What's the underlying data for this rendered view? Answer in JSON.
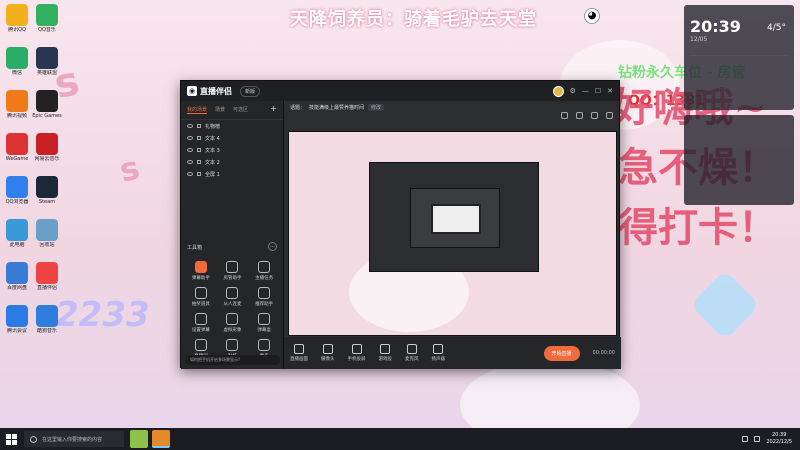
{
  "banner": {
    "title": "天降饲养员：骑着毛驴去天堂"
  },
  "overlay": {
    "fans": "钻粉永久车位 - 房管",
    "qq": "QQ：1381",
    "line1": "~好嗨哦~",
    "line2": "急不燥！",
    "line3": "得打卡！",
    "brand": "2233"
  },
  "desktop_icons": [
    {
      "label": "腾讯QQ",
      "color": "#f2b01e"
    },
    {
      "label": "QQ音乐",
      "color": "#32b060"
    },
    {
      "label": "微信",
      "color": "#2aae67"
    },
    {
      "label": "英雄联盟",
      "color": "#2a3552"
    },
    {
      "label": "腾讯视频",
      "color": "#f07a1a"
    },
    {
      "label": "Epic Games",
      "color": "#222"
    },
    {
      "label": "WeGame",
      "color": "#d33"
    },
    {
      "label": "网易云音乐",
      "color": "#c91f25"
    },
    {
      "label": "QQ浏览器",
      "color": "#2f80ed"
    },
    {
      "label": "Steam",
      "color": "#1b2838"
    },
    {
      "label": "此电脑",
      "color": "#3a9ad9"
    },
    {
      "label": "回收站",
      "color": "#6aa0c8"
    },
    {
      "label": "百度网盘",
      "color": "#3a7bd5"
    },
    {
      "label": "直播伴侣",
      "color": "#e44"
    },
    {
      "label": "腾讯会议",
      "color": "#2c7be5"
    },
    {
      "label": "酷狗音乐",
      "color": "#2f7ddc"
    }
  ],
  "weather_widget": {
    "time": "20:39",
    "temp": "4/5°",
    "date": "12/05"
  },
  "window": {
    "app_name": "直播伴侣",
    "version_tag": "新版",
    "tabs": [
      "我的场景",
      "场景",
      "可选区"
    ],
    "scenes": [
      "礼物榜",
      "文本 4",
      "文本 3",
      "文本 2",
      "全屏 1"
    ],
    "topic_label": "话题：",
    "topic": "技能满级上最赞养猫时间",
    "topic_tag": "修改",
    "tools_title": "工具箱",
    "tools": [
      "弹幕助手",
      "房管助手",
      "主播任务",
      "抽奖道具",
      "从人连麦",
      "推荐助手",
      "设置弹幕",
      "虚拟形象",
      "弹幕盒",
      "直播间",
      "贴纸",
      "更多"
    ],
    "notice": "如何把手机开启多场景显示?",
    "bottom": [
      "直播画面",
      "摄像头",
      "手机投屏",
      "游戏投",
      "麦克风",
      "扬声器"
    ],
    "go_live": "开始直播",
    "timer": "00:00:00"
  },
  "taskbar": {
    "search_placeholder": "在这里输入你要搜索的内容",
    "time": "20:39",
    "date": "2022/12/5"
  }
}
